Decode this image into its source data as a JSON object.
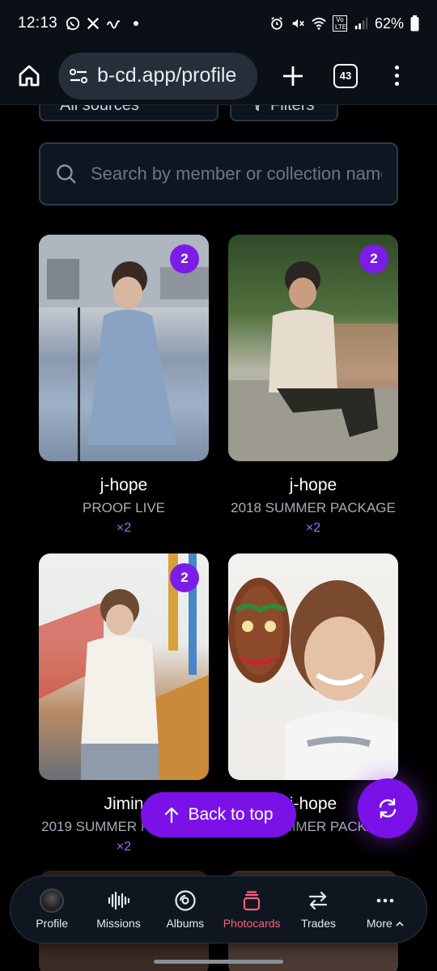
{
  "status_bar": {
    "time": "12:13",
    "left_icons": [
      "whatsapp-icon",
      "x-icon",
      "swirl-icon",
      "dot-icon"
    ],
    "right_icons": [
      "alarm-icon",
      "mute-icon",
      "wifi-icon",
      "volte-icon",
      "signal-icon",
      "battery-icon"
    ],
    "volte_label": "Vo LTE",
    "battery": "62%"
  },
  "browser": {
    "url": "b-cd.app/profile",
    "tab_count": "43"
  },
  "filters": {
    "source_label": "All sources",
    "filters_label": "Filters"
  },
  "search": {
    "placeholder": "Search by member or collection name"
  },
  "cards": [
    {
      "member": "j-hope",
      "collection": "PROOF LIVE",
      "quantity": "×2",
      "badge": "2"
    },
    {
      "member": "j-hope",
      "collection": "2018 SUMMER PACKAGE",
      "quantity": "×2",
      "badge": "2"
    },
    {
      "member": "Jimin",
      "collection": "2019 SUMMER PACKAGE",
      "quantity": "×2",
      "badge": "2"
    },
    {
      "member": "j-hope",
      "collection": "2019 SUMMER PACKAGE",
      "quantity": "",
      "badge": ""
    }
  ],
  "back_to_top": {
    "label": "Back to top"
  },
  "bottom_nav": {
    "items": [
      {
        "label": "Profile",
        "icon": "avatar"
      },
      {
        "label": "Missions",
        "icon": "waveform-icon"
      },
      {
        "label": "Albums",
        "icon": "disc-icon"
      },
      {
        "label": "Photocards",
        "icon": "cards-stack-icon"
      },
      {
        "label": "Trades",
        "icon": "swap-arrows-icon"
      },
      {
        "label": "More",
        "icon": "more-dots-icon"
      }
    ],
    "active": "Photocards"
  },
  "colors": {
    "accent": "#7a12e8",
    "active_nav": "#ff5f7a",
    "quantity": "#a96cf5"
  }
}
